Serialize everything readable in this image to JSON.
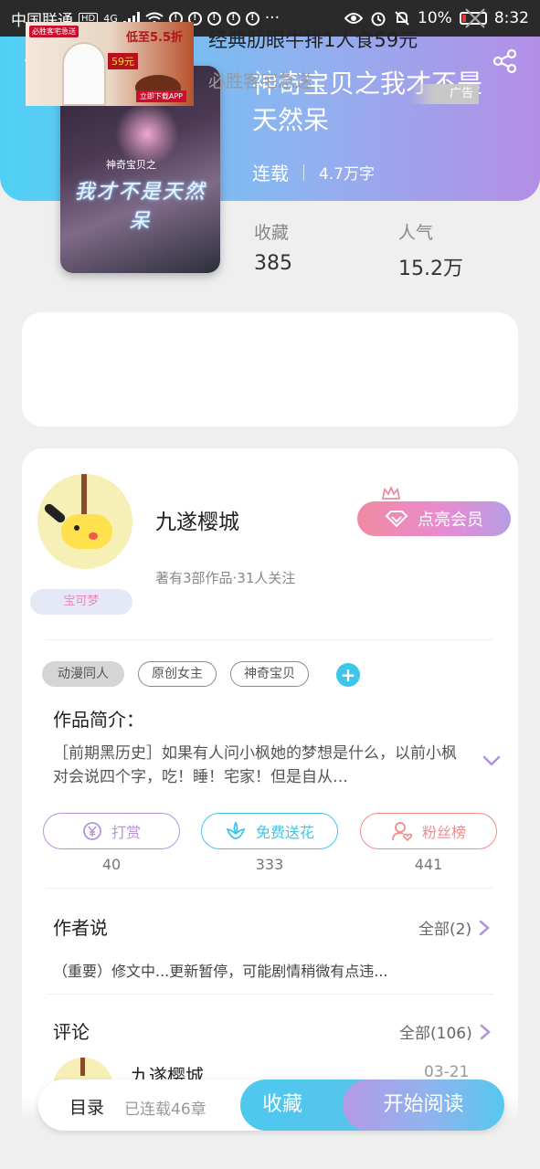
{
  "status_bar": {
    "carrier": "中国联通",
    "hd": "HD",
    "network": "4G",
    "battery_percent": "10%",
    "time": "8:32",
    "more": "···"
  },
  "book": {
    "title": "神奇宝贝之我才不是天然呆",
    "status": "连载",
    "word_count": "4.7万字",
    "stats": {
      "favorites_label": "收藏",
      "favorites_value": "385",
      "popularity_label": "人气",
      "popularity_value": "15.2万"
    },
    "cover": {
      "small_text": "神奇宝贝之",
      "stylized_title": "我才不是天然呆"
    }
  },
  "ad": {
    "title": "经典肋眼牛排1人食59元",
    "subtitle": "必胜客宅急送",
    "tag": "广告",
    "image": {
      "brand": "必胜客宅急送",
      "promo": "低至5.5折",
      "price": "59元",
      "download": "立即下载APP"
    }
  },
  "author": {
    "name": "九遂樱城",
    "meta": "著有3部作品·31人关注",
    "badge": "宝可梦",
    "vip_button": "点亮会员"
  },
  "tags": [
    {
      "label": "动漫同人",
      "style": "filled"
    },
    {
      "label": "原创女主",
      "style": "outline"
    },
    {
      "label": "神奇宝贝",
      "style": "outline"
    }
  ],
  "intro": {
    "heading": "作品简介：",
    "text": "［前期黑历史］如果有人问小枫她的梦想是什么，以前小枫对会说四个字，吃！睡！宅家！但是自从…"
  },
  "actions": [
    {
      "label": "打赏",
      "count": "40",
      "icon": "yen-coin-icon",
      "color": "#b592e0"
    },
    {
      "label": "免费送花",
      "count": "333",
      "icon": "flower-icon",
      "color": "#3ec6ea"
    },
    {
      "label": "粉丝榜",
      "count": "441",
      "icon": "fan-heart-icon",
      "color": "#ef8c8c"
    }
  ],
  "author_says": {
    "heading": "作者说",
    "more": "全部(2)",
    "text": "（重要）修文中...更新暂停，可能剧情稍微有点违..."
  },
  "comments": {
    "heading": "评论",
    "more": "全部(106)",
    "first": {
      "name": "九遂樱城",
      "date": "03-21"
    }
  },
  "bottom_bar": {
    "toc": "目录",
    "chapters": "已连载46章",
    "collect": "收藏",
    "read": "开始阅读"
  },
  "colors": {
    "header_start": "#4fd1f5",
    "header_end": "#b48ee6",
    "accent_cyan": "#3ec6ea",
    "vip_pink": "#f08aa0"
  }
}
